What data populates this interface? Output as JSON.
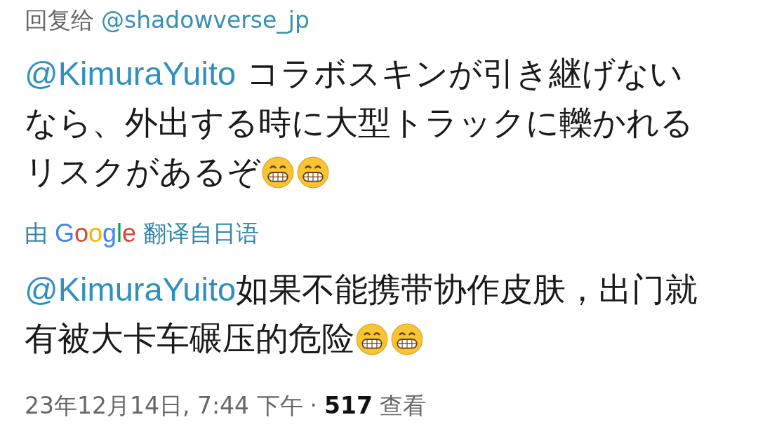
{
  "reply_to": {
    "label": "回复给",
    "handle": "@shadowverse_jp"
  },
  "original": {
    "mention": "@KimuraYuito",
    "text": " コラボスキンが引き継げないなら、外出する時に大型トラックに轢かれるリスクがあるぞ"
  },
  "translation_label": {
    "prefix": "由",
    "brand": "Google",
    "suffix": "翻译自日语"
  },
  "translation": {
    "mention": "@KimuraYuito",
    "text": "如果不能携带协作皮肤，出门就有被大卡车碾压的危险"
  },
  "meta": {
    "timestamp": "23年12月14日, 7:44 下午",
    "separator": "·",
    "views": "517",
    "views_label": "查看"
  }
}
